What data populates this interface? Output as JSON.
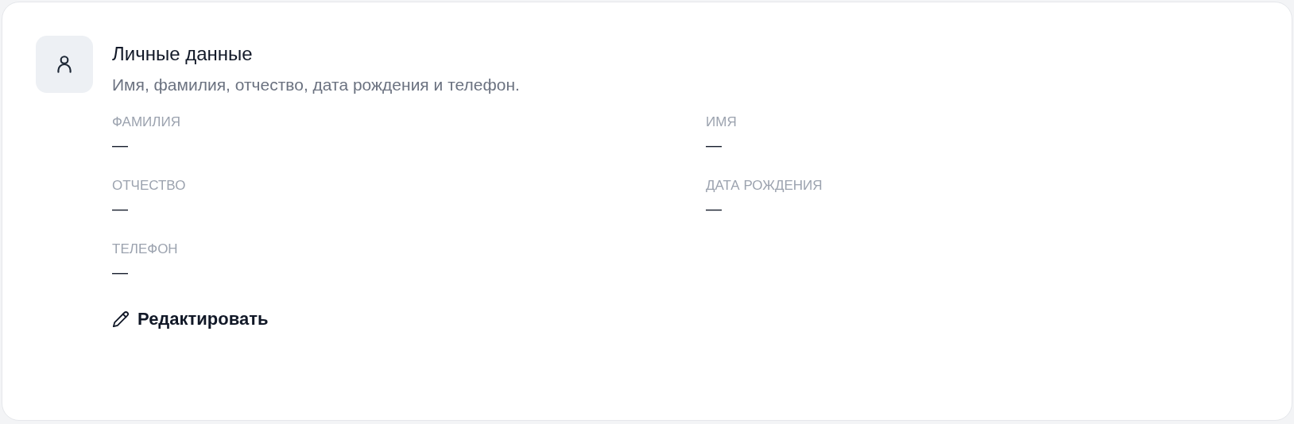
{
  "section": {
    "title": "Личные данные",
    "subtitle": "Имя, фамилия, отчество, дата рождения и телефон."
  },
  "fields": [
    {
      "label": "ФАМИЛИЯ",
      "value": "—"
    },
    {
      "label": "ИМЯ",
      "value": "—"
    },
    {
      "label": "ОТЧЕСТВО",
      "value": "—"
    },
    {
      "label": "ДАТА РОЖДЕНИЯ",
      "value": "—"
    },
    {
      "label": "ТЕЛЕФОН",
      "value": "—"
    }
  ],
  "edit_button": {
    "label": "Редактировать"
  }
}
